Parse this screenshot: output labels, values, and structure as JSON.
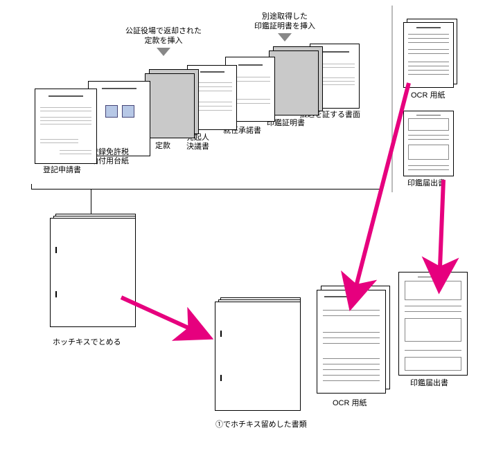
{
  "insertions": {
    "teikan": "公証役場で返却された\n定款を挿入",
    "inkan": "別途取得した\n印鑑証明書を挿入"
  },
  "top_docs": {
    "d1": "登記申請書",
    "d2": "登録免許税\n納付用台紙",
    "d3": "定款",
    "d4": "発起人\n決議書",
    "d5": "就任承諾書",
    "d6": "印鑑証明書",
    "d7": "払込を証する書面"
  },
  "right_col": {
    "ocr": "OCR 用紙",
    "inkan": "印鑑届出書"
  },
  "bottom": {
    "staple_note": "ホッチキスでとめる",
    "bundled": "①でホチキス留めした書類",
    "ocr": "OCR 用紙",
    "inkan": "印鑑届出書"
  }
}
